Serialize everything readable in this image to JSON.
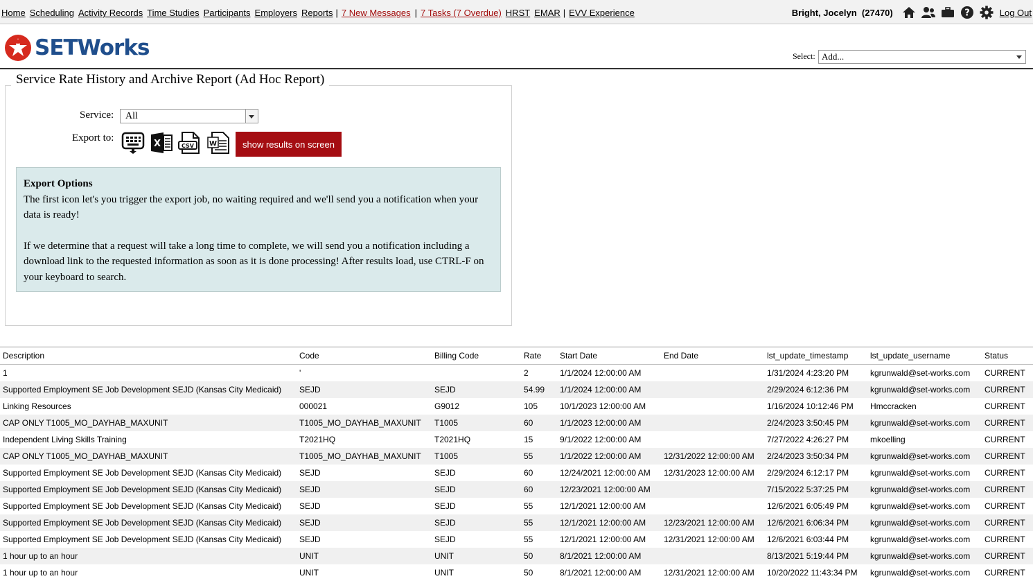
{
  "nav": {
    "links": [
      {
        "label": "Home",
        "red": false
      },
      {
        "label": "Scheduling",
        "red": false
      },
      {
        "label": "Activity Records",
        "red": false
      },
      {
        "label": "Time Studies",
        "red": false
      },
      {
        "label": "Participants",
        "red": false
      },
      {
        "label": "Employers",
        "red": false
      },
      {
        "label": "Reports",
        "red": false
      }
    ],
    "messages": "7 New Messages",
    "tasks": "7 Tasks (7 Overdue)",
    "links2": [
      "HRST",
      "EMAR"
    ],
    "evv": "EVV Experience",
    "separator": "|"
  },
  "user": {
    "name": "Bright, Jocelyn",
    "id": "(27470)",
    "logout": "Log Out",
    "icons": [
      "home-icon",
      "users-icon",
      "briefcase-icon",
      "help-icon",
      "gear-icon"
    ]
  },
  "logo": {
    "text": "SETWorks"
  },
  "select": {
    "label": "Select:",
    "value": "Add..."
  },
  "report": {
    "title": "Service Rate History and Archive Report (Ad Hoc Report)",
    "service_label": "Service:",
    "service_value": "All",
    "export_label": "Export to:",
    "export_icons": [
      "background-export-icon",
      "excel-icon",
      "csv-icon",
      "word-icon"
    ],
    "show_button": "show results on screen",
    "options_title": "Export Options",
    "options_p1": "The first icon let's you trigger the export job, no waiting required and we'll send you a notification when your data is ready!",
    "options_p2": "If we determine that a request will take a long time to complete, we will send you a notification including a download link to the requested information as soon as it is done processing! After results load, use CTRL-F on your keyboard to search."
  },
  "colors": {
    "brand_red": "#a50d12",
    "link_red": "#a30d0d",
    "options_bg": "#daeaeb",
    "logo_blue": "#1f4e8c"
  },
  "table": {
    "headers": [
      "Description",
      "Code",
      "Billing Code",
      "Rate",
      "Start Date",
      "End Date",
      "lst_update_timestamp",
      "lst_update_username",
      "Status"
    ],
    "rows": [
      [
        "1",
        "'",
        "",
        "2",
        "1/1/2024 12:00:00 AM",
        "",
        "1/31/2024 4:23:20 PM",
        "kgrunwald@set-works.com",
        "CURRENT"
      ],
      [
        "Supported Employment SE Job Development SEJD (Kansas City Medicaid)",
        "SEJD",
        "SEJD",
        "54.99",
        "1/1/2024 12:00:00 AM",
        "",
        "2/29/2024 6:12:36 PM",
        "kgrunwald@set-works.com",
        "CURRENT"
      ],
      [
        "Linking Resources",
        "000021",
        "G9012",
        "105",
        "10/1/2023 12:00:00 AM",
        "",
        "1/16/2024 10:12:46 PM",
        "Hmccracken",
        "CURRENT"
      ],
      [
        "CAP ONLY T1005_MO_DAYHAB_MAXUNIT",
        "T1005_MO_DAYHAB_MAXUNIT",
        "T1005",
        "60",
        "1/1/2023 12:00:00 AM",
        "",
        "2/24/2023 3:50:45 PM",
        "kgrunwald@set-works.com",
        "CURRENT"
      ],
      [
        "Independent Living Skills Training",
        "T2021HQ",
        "T2021HQ",
        "15",
        "9/1/2022 12:00:00 AM",
        "",
        "7/27/2022 4:26:27 PM",
        "mkoelling",
        "CURRENT"
      ],
      [
        "CAP ONLY T1005_MO_DAYHAB_MAXUNIT",
        "T1005_MO_DAYHAB_MAXUNIT",
        "T1005",
        "55",
        "1/1/2022 12:00:00 AM",
        "12/31/2022 12:00:00 AM",
        "2/24/2023 3:50:34 PM",
        "kgrunwald@set-works.com",
        "CURRENT"
      ],
      [
        "Supported Employment SE Job Development SEJD (Kansas City Medicaid)",
        "SEJD",
        "SEJD",
        "60",
        "12/24/2021 12:00:00 AM",
        "12/31/2023 12:00:00 AM",
        "2/29/2024 6:12:17 PM",
        "kgrunwald@set-works.com",
        "CURRENT"
      ],
      [
        "Supported Employment SE Job Development SEJD (Kansas City Medicaid)",
        "SEJD",
        "SEJD",
        "60",
        "12/23/2021 12:00:00 AM",
        "",
        "7/15/2022 5:37:25 PM",
        "kgrunwald@set-works.com",
        "CURRENT"
      ],
      [
        "Supported Employment SE Job Development SEJD (Kansas City Medicaid)",
        "SEJD",
        "SEJD",
        "55",
        "12/1/2021 12:00:00 AM",
        "",
        "12/6/2021 6:05:49 PM",
        "kgrunwald@set-works.com",
        "CURRENT"
      ],
      [
        "Supported Employment SE Job Development SEJD (Kansas City Medicaid)",
        "SEJD",
        "SEJD",
        "55",
        "12/1/2021 12:00:00 AM",
        "12/23/2021 12:00:00 AM",
        "12/6/2021 6:06:34 PM",
        "kgrunwald@set-works.com",
        "CURRENT"
      ],
      [
        "Supported Employment SE Job Development SEJD (Kansas City Medicaid)",
        "SEJD",
        "SEJD",
        "55",
        "12/1/2021 12:00:00 AM",
        "12/31/2021 12:00:00 AM",
        "12/6/2021 6:03:44 PM",
        "kgrunwald@set-works.com",
        "CURRENT"
      ],
      [
        "1 hour up to an hour",
        "UNIT",
        "UNIT",
        "50",
        "8/1/2021 12:00:00 AM",
        "",
        "8/13/2021 5:19:44 PM",
        "kgrunwald@set-works.com",
        "CURRENT"
      ],
      [
        "1 hour up to an hour",
        "UNIT",
        "UNIT",
        "50",
        "8/1/2021 12:00:00 AM",
        "12/31/2021 12:00:00 AM",
        "10/20/2022 11:43:34 PM",
        "kgrunwald@set-works.com",
        "CURRENT"
      ]
    ]
  }
}
